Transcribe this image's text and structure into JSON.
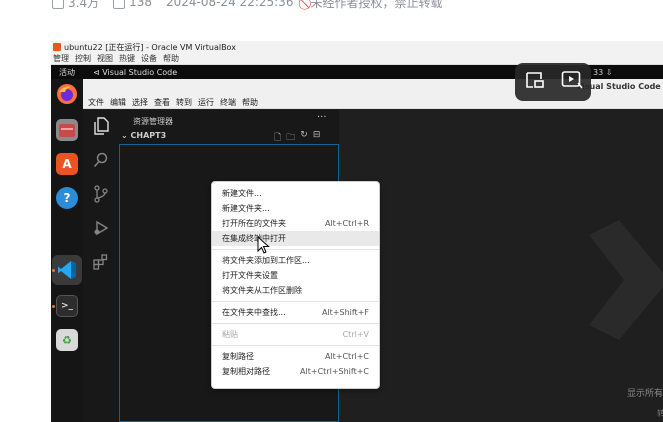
{
  "meta": {
    "duration": "3.4万",
    "count": "138",
    "datetime": "2024-08-24 22:25:36",
    "notice": "未经作者授权，禁止转载"
  },
  "vbox": {
    "title": "ubuntu22 [正在运行] - Oracle VM VirtualBox",
    "menu": [
      "管理",
      "控制",
      "视图",
      "热键",
      "设备",
      "帮助"
    ]
  },
  "ubuntu": {
    "activities": "活动",
    "app_name": "Visual Studio Code",
    "clock": "33"
  },
  "vscode": {
    "title": "Visual Studio Code",
    "menu": [
      "文件",
      "编辑",
      "选择",
      "查看",
      "转到",
      "运行",
      "终端",
      "帮助"
    ],
    "explorer_header": "资源管理器",
    "folder": "CHAPT3",
    "editor_hint": "显示所有",
    "editor_hint2": "转到"
  },
  "context_menu": {
    "items": [
      {
        "label": "新建文件...",
        "key": ""
      },
      {
        "label": "新建文件夹...",
        "key": ""
      },
      {
        "label": "打开所在的文件夹",
        "key": "Alt+Ctrl+R"
      },
      {
        "label": "在集成终端中打开",
        "key": ""
      },
      {
        "label": "将文件夹添加到工作区...",
        "key": ""
      },
      {
        "label": "打开文件夹设置",
        "key": ""
      },
      {
        "label": "将文件夹从工作区删除",
        "key": ""
      },
      {
        "label": "在文件夹中查找...",
        "key": "Alt+Shift+F"
      },
      {
        "label": "粘贴",
        "key": "Ctrl+V"
      },
      {
        "label": "复制路径",
        "key": "Alt+Ctrl+C"
      },
      {
        "label": "复制相对路径",
        "key": "Alt+Ctrl+Shift+C"
      }
    ]
  },
  "colors": {
    "accent": "#0e639c",
    "vscode_bg": "#1f1f1f",
    "sidebar_bg": "#181818",
    "notice_red": "#e0453a"
  }
}
